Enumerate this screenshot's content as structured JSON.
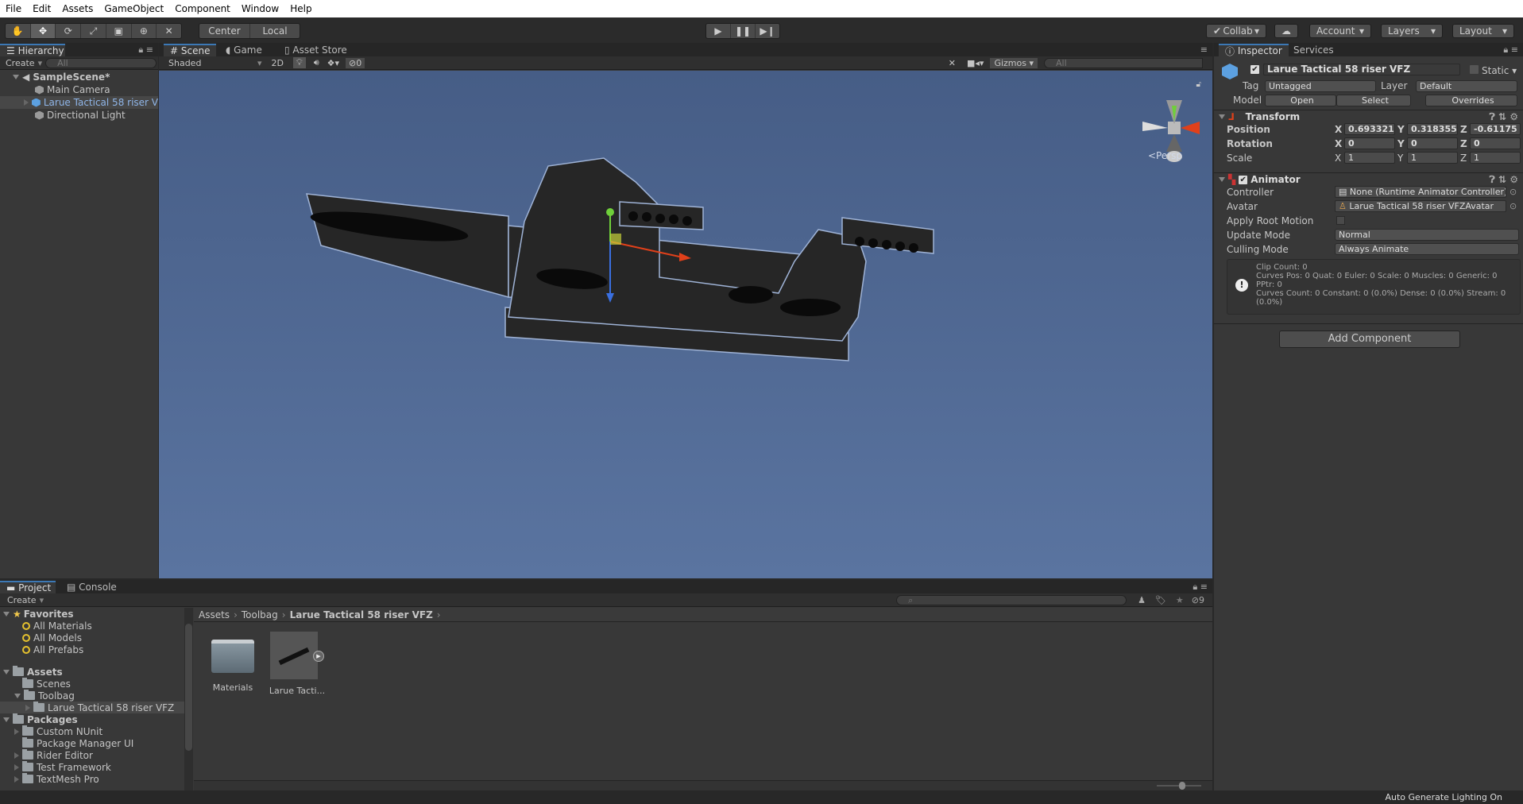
{
  "menu": [
    "File",
    "Edit",
    "Assets",
    "GameObject",
    "Component",
    "Window",
    "Help"
  ],
  "toolbar": {
    "tools": [
      "hand-icon",
      "move-icon",
      "rotate-icon",
      "scale-icon",
      "rect-icon",
      "transform-icon",
      "custom-tool-icon"
    ],
    "pivot": "Center",
    "space": "Local",
    "collab": "Collab",
    "account": "Account",
    "layers": "Layers",
    "layout": "Layout"
  },
  "hierarchy": {
    "tab": "Hierarchy",
    "create": "Create",
    "search_placeholder": "All",
    "scene": "SampleScene*",
    "items": [
      {
        "label": "Main Camera"
      },
      {
        "label": "Larue Tactical 58 riser V"
      },
      {
        "label": "Directional Light"
      }
    ]
  },
  "scene": {
    "tabs": [
      "Scene",
      "Game",
      "Asset Store"
    ],
    "shading": "Shaded",
    "mode_2d": "2D",
    "hidden_count": "0",
    "gizmos": "Gizmos",
    "search_placeholder": "All",
    "projection": "Persp",
    "background_color": "#4f6890"
  },
  "inspector": {
    "tabs": [
      "Inspector",
      "Services"
    ],
    "object_name": "Larue Tactical 58 riser VFZ",
    "static_label": "Static",
    "tag_label": "Tag",
    "tag": "Untagged",
    "layer_label": "Layer",
    "layer": "Default",
    "model_label": "Model",
    "open": "Open",
    "select": "Select",
    "overrides": "Overrides",
    "transform": {
      "title": "Transform",
      "position": {
        "label": "Position",
        "x": "0.693321",
        "y": "0.318355",
        "z": "-0.61175"
      },
      "rotation": {
        "label": "Rotation",
        "x": "0",
        "y": "0",
        "z": "0"
      },
      "scale": {
        "label": "Scale",
        "x": "1",
        "y": "1",
        "z": "1"
      }
    },
    "animator": {
      "title": "Animator",
      "controller_label": "Controller",
      "controller": "None (Runtime Animator Controller)",
      "avatar_label": "Avatar",
      "avatar": "Larue Tactical 58 riser VFZAvatar",
      "root_motion_label": "Apply Root Motion",
      "root_motion": false,
      "update_label": "Update Mode",
      "update": "Normal",
      "culling_label": "Culling Mode",
      "culling": "Always Animate",
      "info": [
        "Clip Count: 0",
        "Curves Pos: 0 Quat: 0 Euler: 0 Scale: 0 Muscles: 0 Generic: 0",
        "PPtr: 0",
        "Curves Count: 0 Constant: 0 (0.0%) Dense: 0 (0.0%) Stream: 0",
        "(0.0%)"
      ]
    },
    "add_component": "Add Component"
  },
  "project": {
    "tabs": [
      "Project",
      "Console"
    ],
    "create": "Create",
    "hidden_count": "9",
    "favorites": {
      "label": "Favorites",
      "items": [
        "All Materials",
        "All Models",
        "All Prefabs"
      ]
    },
    "assets": {
      "label": "Assets",
      "items": [
        "Scenes",
        "Toolbag",
        "Larue Tactical 58 riser VFZ"
      ]
    },
    "packages": {
      "label": "Packages",
      "items": [
        "Custom NUnit",
        "Package Manager UI",
        "Rider Editor",
        "Test Framework",
        "TextMesh Pro"
      ]
    },
    "breadcrumb": [
      "Assets",
      "Toolbag",
      "Larue Tactical 58 riser VFZ"
    ],
    "grid": [
      {
        "label": "Materials"
      },
      {
        "label": "Larue Tacti..."
      }
    ]
  },
  "status": "Auto Generate Lighting On"
}
